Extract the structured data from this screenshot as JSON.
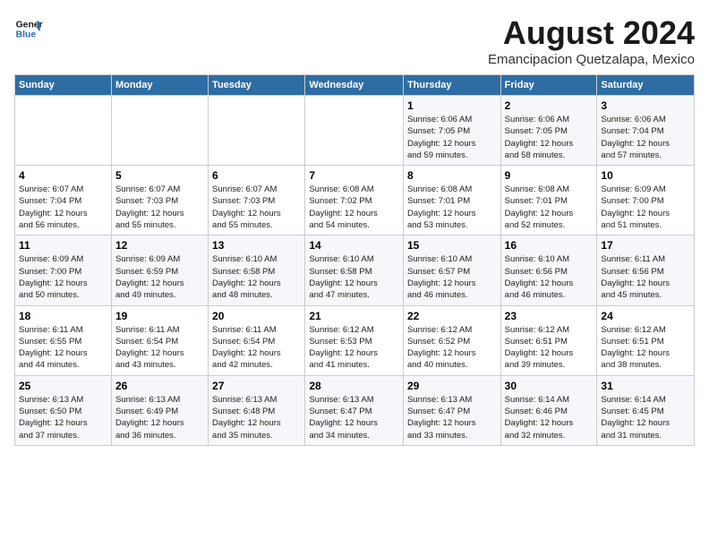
{
  "header": {
    "logo_line1": "General",
    "logo_line2": "Blue",
    "month_title": "August 2024",
    "subtitle": "Emancipacion Quetzalapa, Mexico"
  },
  "days_of_week": [
    "Sunday",
    "Monday",
    "Tuesday",
    "Wednesday",
    "Thursday",
    "Friday",
    "Saturday"
  ],
  "weeks": [
    [
      {
        "day": "",
        "info": ""
      },
      {
        "day": "",
        "info": ""
      },
      {
        "day": "",
        "info": ""
      },
      {
        "day": "",
        "info": ""
      },
      {
        "day": "1",
        "info": "Sunrise: 6:06 AM\nSunset: 7:05 PM\nDaylight: 12 hours\nand 59 minutes."
      },
      {
        "day": "2",
        "info": "Sunrise: 6:06 AM\nSunset: 7:05 PM\nDaylight: 12 hours\nand 58 minutes."
      },
      {
        "day": "3",
        "info": "Sunrise: 6:06 AM\nSunset: 7:04 PM\nDaylight: 12 hours\nand 57 minutes."
      }
    ],
    [
      {
        "day": "4",
        "info": "Sunrise: 6:07 AM\nSunset: 7:04 PM\nDaylight: 12 hours\nand 56 minutes."
      },
      {
        "day": "5",
        "info": "Sunrise: 6:07 AM\nSunset: 7:03 PM\nDaylight: 12 hours\nand 55 minutes."
      },
      {
        "day": "6",
        "info": "Sunrise: 6:07 AM\nSunset: 7:03 PM\nDaylight: 12 hours\nand 55 minutes."
      },
      {
        "day": "7",
        "info": "Sunrise: 6:08 AM\nSunset: 7:02 PM\nDaylight: 12 hours\nand 54 minutes."
      },
      {
        "day": "8",
        "info": "Sunrise: 6:08 AM\nSunset: 7:01 PM\nDaylight: 12 hours\nand 53 minutes."
      },
      {
        "day": "9",
        "info": "Sunrise: 6:08 AM\nSunset: 7:01 PM\nDaylight: 12 hours\nand 52 minutes."
      },
      {
        "day": "10",
        "info": "Sunrise: 6:09 AM\nSunset: 7:00 PM\nDaylight: 12 hours\nand 51 minutes."
      }
    ],
    [
      {
        "day": "11",
        "info": "Sunrise: 6:09 AM\nSunset: 7:00 PM\nDaylight: 12 hours\nand 50 minutes."
      },
      {
        "day": "12",
        "info": "Sunrise: 6:09 AM\nSunset: 6:59 PM\nDaylight: 12 hours\nand 49 minutes."
      },
      {
        "day": "13",
        "info": "Sunrise: 6:10 AM\nSunset: 6:58 PM\nDaylight: 12 hours\nand 48 minutes."
      },
      {
        "day": "14",
        "info": "Sunrise: 6:10 AM\nSunset: 6:58 PM\nDaylight: 12 hours\nand 47 minutes."
      },
      {
        "day": "15",
        "info": "Sunrise: 6:10 AM\nSunset: 6:57 PM\nDaylight: 12 hours\nand 46 minutes."
      },
      {
        "day": "16",
        "info": "Sunrise: 6:10 AM\nSunset: 6:56 PM\nDaylight: 12 hours\nand 46 minutes."
      },
      {
        "day": "17",
        "info": "Sunrise: 6:11 AM\nSunset: 6:56 PM\nDaylight: 12 hours\nand 45 minutes."
      }
    ],
    [
      {
        "day": "18",
        "info": "Sunrise: 6:11 AM\nSunset: 6:55 PM\nDaylight: 12 hours\nand 44 minutes."
      },
      {
        "day": "19",
        "info": "Sunrise: 6:11 AM\nSunset: 6:54 PM\nDaylight: 12 hours\nand 43 minutes."
      },
      {
        "day": "20",
        "info": "Sunrise: 6:11 AM\nSunset: 6:54 PM\nDaylight: 12 hours\nand 42 minutes."
      },
      {
        "day": "21",
        "info": "Sunrise: 6:12 AM\nSunset: 6:53 PM\nDaylight: 12 hours\nand 41 minutes."
      },
      {
        "day": "22",
        "info": "Sunrise: 6:12 AM\nSunset: 6:52 PM\nDaylight: 12 hours\nand 40 minutes."
      },
      {
        "day": "23",
        "info": "Sunrise: 6:12 AM\nSunset: 6:51 PM\nDaylight: 12 hours\nand 39 minutes."
      },
      {
        "day": "24",
        "info": "Sunrise: 6:12 AM\nSunset: 6:51 PM\nDaylight: 12 hours\nand 38 minutes."
      }
    ],
    [
      {
        "day": "25",
        "info": "Sunrise: 6:13 AM\nSunset: 6:50 PM\nDaylight: 12 hours\nand 37 minutes."
      },
      {
        "day": "26",
        "info": "Sunrise: 6:13 AM\nSunset: 6:49 PM\nDaylight: 12 hours\nand 36 minutes."
      },
      {
        "day": "27",
        "info": "Sunrise: 6:13 AM\nSunset: 6:48 PM\nDaylight: 12 hours\nand 35 minutes."
      },
      {
        "day": "28",
        "info": "Sunrise: 6:13 AM\nSunset: 6:47 PM\nDaylight: 12 hours\nand 34 minutes."
      },
      {
        "day": "29",
        "info": "Sunrise: 6:13 AM\nSunset: 6:47 PM\nDaylight: 12 hours\nand 33 minutes."
      },
      {
        "day": "30",
        "info": "Sunrise: 6:14 AM\nSunset: 6:46 PM\nDaylight: 12 hours\nand 32 minutes."
      },
      {
        "day": "31",
        "info": "Sunrise: 6:14 AM\nSunset: 6:45 PM\nDaylight: 12 hours\nand 31 minutes."
      }
    ]
  ]
}
